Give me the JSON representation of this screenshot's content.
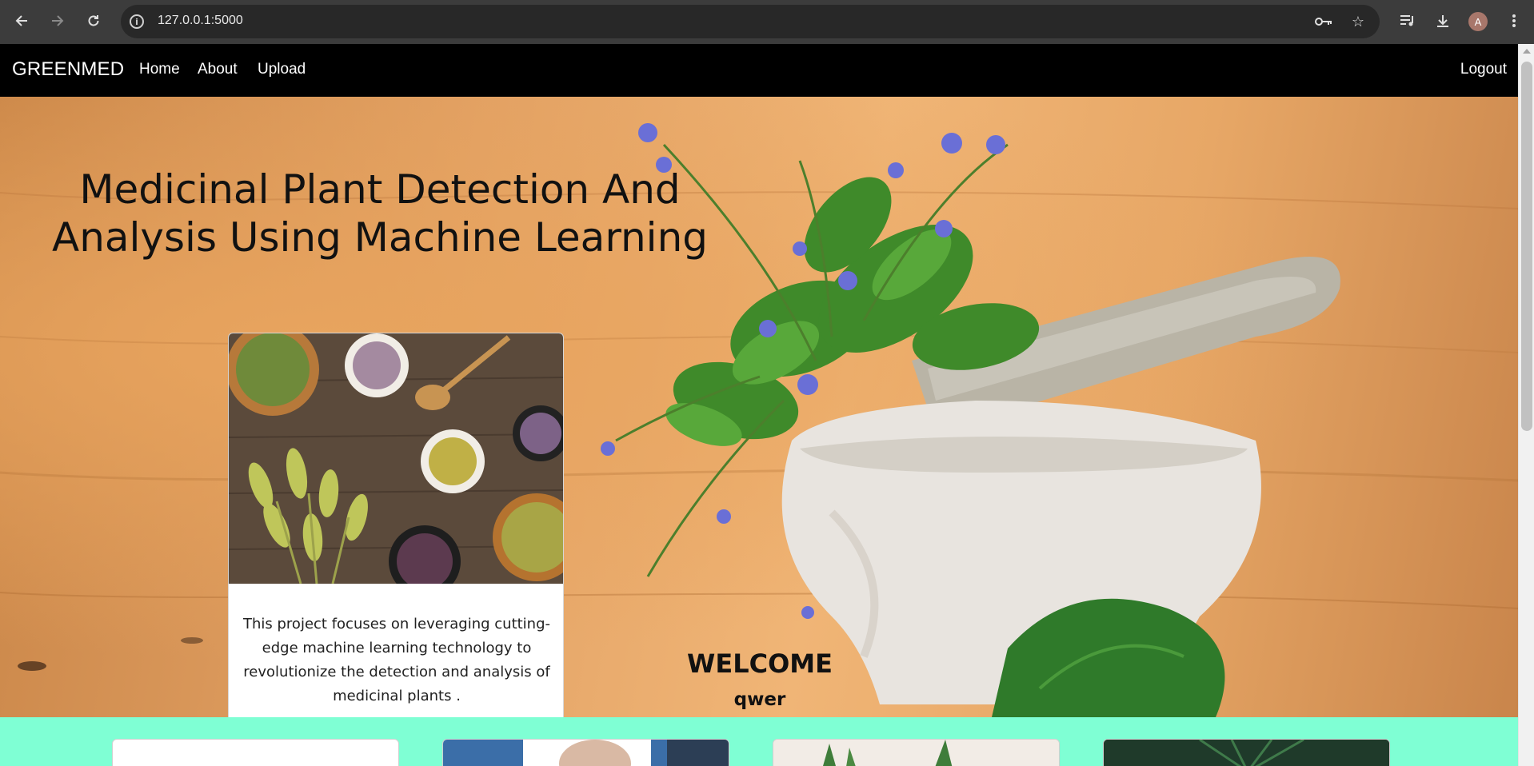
{
  "browser": {
    "url": "127.0.0.1:5000",
    "profile_initial": "A",
    "icons": {
      "back": "back-arrow-icon",
      "forward": "forward-arrow-icon",
      "reload": "reload-icon",
      "site_info": "site-info-icon",
      "password": "key-icon",
      "bookmark": "star-icon",
      "media": "media-controls-icon",
      "downloads": "download-icon",
      "menu": "kebab-menu-icon"
    }
  },
  "navbar": {
    "brand": "GREENMED",
    "links": [
      "Home",
      "About",
      "Upload"
    ],
    "logout": "Logout"
  },
  "hero": {
    "title": "Medicinal Plant Detection And Analysis Using Machine Learning",
    "card_text": "This project focuses on leveraging cutting-edge machine learning technology to revolutionize the detection and analysis of medicinal plants .",
    "welcome": "WELCOME",
    "username": "qwer"
  },
  "colors": {
    "navbar_bg": "#000000",
    "mint_section_bg": "#7fffd4",
    "hero_bg": "#e2a164"
  }
}
